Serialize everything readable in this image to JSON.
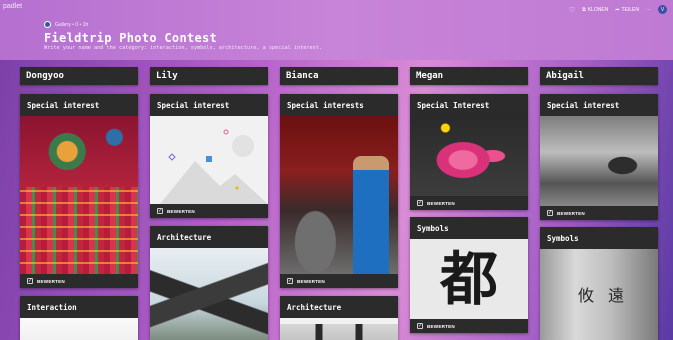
{
  "header": {
    "logo": "padlet",
    "meta": "Gallery • 0 • 1h",
    "title": "Fieldtrip Photo Contest",
    "subtitle": "Write your name and the category: interaction, symbols, architecture, a special interest.",
    "actions": {
      "remix": "KLONEN",
      "share": "TEILEN",
      "more": "···",
      "user_initial": "V"
    }
  },
  "colors": {
    "accent": "#c47fd6",
    "card_bg": "#2b2b2b"
  },
  "rate_label": "BEWERTEN",
  "columns": [
    {
      "name": "Dongyoo",
      "cards": [
        {
          "title": "Special interest"
        },
        {
          "title": "Interaction"
        }
      ]
    },
    {
      "name": "Lily",
      "cards": [
        {
          "title": "Special interest"
        },
        {
          "title": "Architecture"
        }
      ]
    },
    {
      "name": "Bianca",
      "cards": [
        {
          "title": "Special interests"
        },
        {
          "title": "Architecture"
        }
      ]
    },
    {
      "name": "Megan",
      "cards": [
        {
          "title": "Special Interest"
        },
        {
          "title": "Symbols"
        }
      ]
    },
    {
      "name": "Abigail",
      "cards": [
        {
          "title": "Special interest"
        },
        {
          "title": "Symbols"
        }
      ]
    }
  ],
  "images": {
    "calligraphy_char": "都",
    "stone_chars": [
      "攸",
      "遠"
    ]
  }
}
